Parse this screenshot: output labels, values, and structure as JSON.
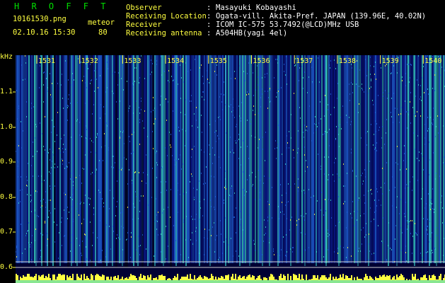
{
  "header": {
    "brand": "H R O F F T",
    "filename": "10161530.png",
    "mode": "meteor",
    "datetime": "02.10.16 15:30",
    "count": "80",
    "fields": [
      {
        "label": "Observer",
        "value": "Masayuki Kobayashi"
      },
      {
        "label": "Receiving Location",
        "value": "Ogata-vill. Akita-Pref. JAPAN (139.96E, 40.02N)"
      },
      {
        "label": "Receiver",
        "value": "ICOM IC-575 53.7492(@LCD)MHz USB"
      },
      {
        "label": "Receiving antenna",
        "value": "A504HB(yagi 4el)"
      }
    ]
  },
  "spectrogram": {
    "y_unit": "kHz",
    "y_ticks": [
      "1.1",
      "1.0",
      "0.9",
      "0.8",
      "0.7",
      "0.6"
    ],
    "time_marks": [
      "1531",
      "1532",
      "1533",
      "1534",
      "1535",
      "1536",
      "1537",
      "1538",
      "1539",
      "1540"
    ],
    "colors": {
      "background": "#000033",
      "low": "#0a1a8c",
      "mid": "#1f5fd6",
      "high": "#3ad6c8",
      "peak": "#ffff40",
      "axis": "#ffff40",
      "text_label": "#ffff40"
    }
  }
}
